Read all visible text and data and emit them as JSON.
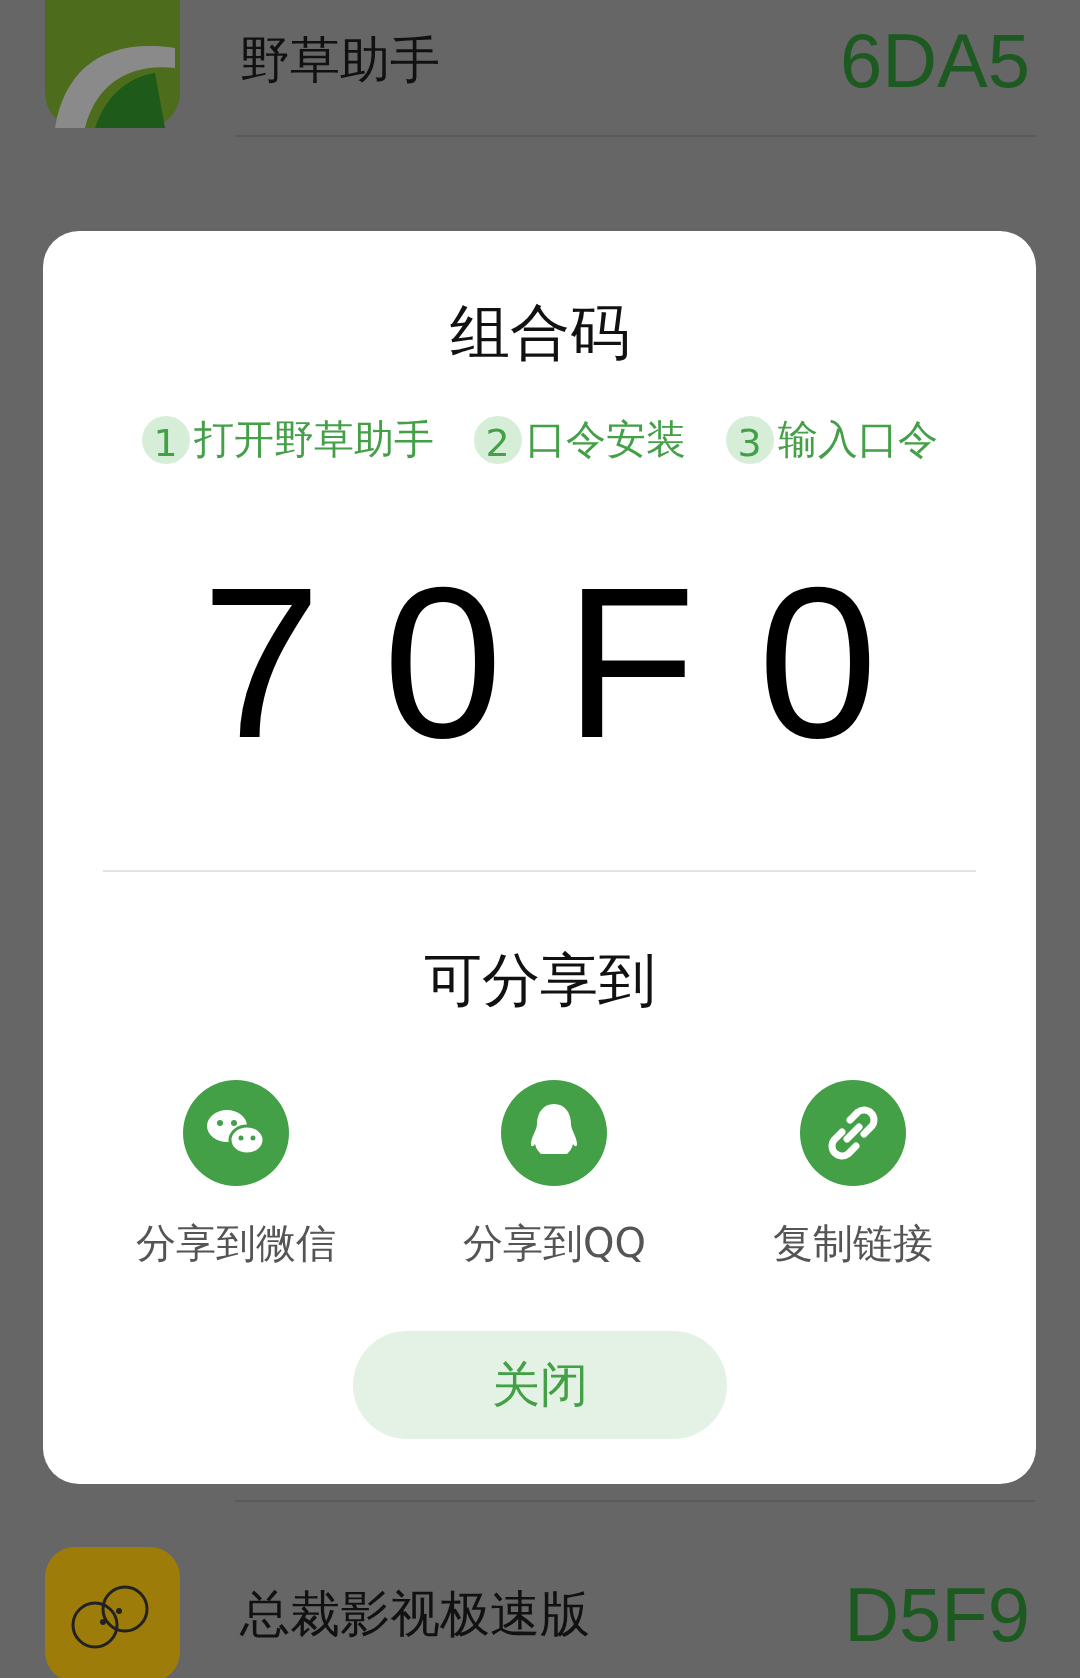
{
  "background_list": [
    {
      "kind": "grass",
      "name": "野草助手",
      "code": "6DA5"
    },
    {
      "kind": "tv",
      "name": "总裁影视极速版",
      "code": "D5F9"
    }
  ],
  "dialog": {
    "title": "组合码",
    "steps": [
      {
        "number": "1",
        "label": "打开野草助手"
      },
      {
        "number": "2",
        "label": "口令安装"
      },
      {
        "number": "3",
        "label": "输入口令"
      }
    ],
    "code": "70F0",
    "share_title": "可分享到",
    "share_options": [
      {
        "kind": "wechat",
        "label": "分享到微信"
      },
      {
        "kind": "qq",
        "label": "分享到QQ"
      },
      {
        "kind": "link",
        "label": "复制链接"
      }
    ],
    "close_button": "关闭"
  }
}
